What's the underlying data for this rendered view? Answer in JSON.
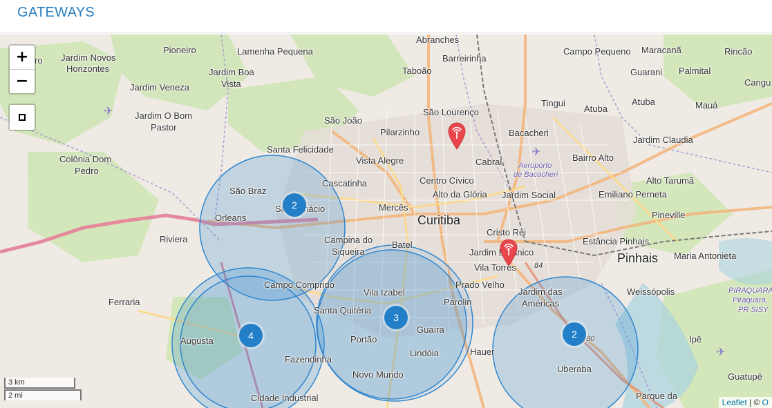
{
  "header": {
    "title": "GATEWAYS"
  },
  "map": {
    "controls": {
      "zoom_in": "+",
      "zoom_out": "−"
    },
    "scale": {
      "km": "3 km",
      "mi": "2 mi"
    },
    "attribution": {
      "link": "Leaflet",
      "sep": " | © ",
      "tail": "O"
    },
    "labels": {
      "jardim_novos": "Jardim Novos",
      "horizontes": "Horizontes",
      "pioneiro": "Pioneiro",
      "lamenha": "Lamenha Pequena",
      "abranches": "Abranches",
      "barreirinha": "Barreirinha",
      "campo_pequeno": "Campo Pequeno",
      "maracana": "Maracanã",
      "rincao": "Rincão",
      "jardim_boa": "Jardim Boa",
      "vista": "Vista",
      "taboao": "Taboão",
      "guarani": "Guarani",
      "palmital": "Palmital",
      "cangu": "Cangu",
      "jardim_veneza": "Jardim Veneza",
      "tingui": "Tingui",
      "atuba1": "Atuba",
      "atuba2": "Atuba",
      "maua": "Mauá",
      "jardim_o_bom": "Jardim O Bom",
      "pastor": "Pastor",
      "sao_joao": "São João",
      "sao_lourenco": "São Lourenço",
      "pilarzinho": "Pilarzinho",
      "bacacheri": "Bacacheri",
      "jardim_claudia": "Jardim Claudia",
      "santa_felicidade": "Santa Felicidade",
      "colonia_dom": "Colônia Dom",
      "pedro": "Pedro",
      "vista_alegre": "Vista Alegre",
      "cabral": "Cabral",
      "bairro_alto": "Bairro Alto",
      "aeroporto": "Aeroporto",
      "de_bacacheri": "de Bacacheri",
      "sao_braz": "São Braz",
      "cascatinha": "Cascatinha",
      "centro_civico": "Centro Cívico",
      "alto_tarumã": "Alto Tarumã",
      "alto_da_gloria": "Alto da Glória",
      "jardim_social": "Jardim Social",
      "emiliano": "Emiliano Perneta",
      "santo_inacio": "Santo Inácio",
      "merces": "Mercês",
      "orleans": "Orleans",
      "curitiba": "Curitiba",
      "pineville": "Pineville",
      "riviera": "Riviera",
      "cristo_rei": "Cristo Rei",
      "estancia": "Estância Pinhais",
      "campina": "Campina do",
      "siqueira": "Siqueira",
      "batel": "Batel",
      "jardim_botanico": "Jardim Botânico",
      "pinhais": "Pinhais",
      "maria_antonieta": "Maria Antonieta",
      "vila_torres": "Vila Torres",
      "campo_comprido": "Campo Comprido",
      "prado_velho": "Prado Velho",
      "piraquara1": "PIRAQUARA",
      "piraquara2": "Piraquara,",
      "pr_sisy": "PR SISY",
      "vila_izabel": "Vila Izabel",
      "weissopolis": "Weissópolis",
      "ferraria": "Ferraria",
      "santa_quiteria": "Santa Quitéria",
      "parolin": "Parolin",
      "jardim_das": "Jardim das",
      "americas": "Américas",
      "guaira": "Guaíra",
      "augusta": "Augusta",
      "portao": "Portão",
      "ipe": "Ipê",
      "lindoia": "Lindóia",
      "hauer": "Hauer",
      "fazendinha": "Fazendinha",
      "uberaba": "Uberaba",
      "guatupe": "Guatupê",
      "novo_mundo": "Novo Mundo",
      "cidade_industrial": "Cidade Industrial",
      "parque_da": "Parque da",
      "partial_ro": "ro",
      "road84a": "84",
      "road80": "80"
    }
  },
  "clusters": [
    {
      "label": "2"
    },
    {
      "label": "4"
    },
    {
      "label": "3"
    },
    {
      "label": "2"
    }
  ],
  "colors": {
    "accent": "#2a7fc0",
    "cluster": "#2380c8",
    "pin": "#e8464b"
  }
}
